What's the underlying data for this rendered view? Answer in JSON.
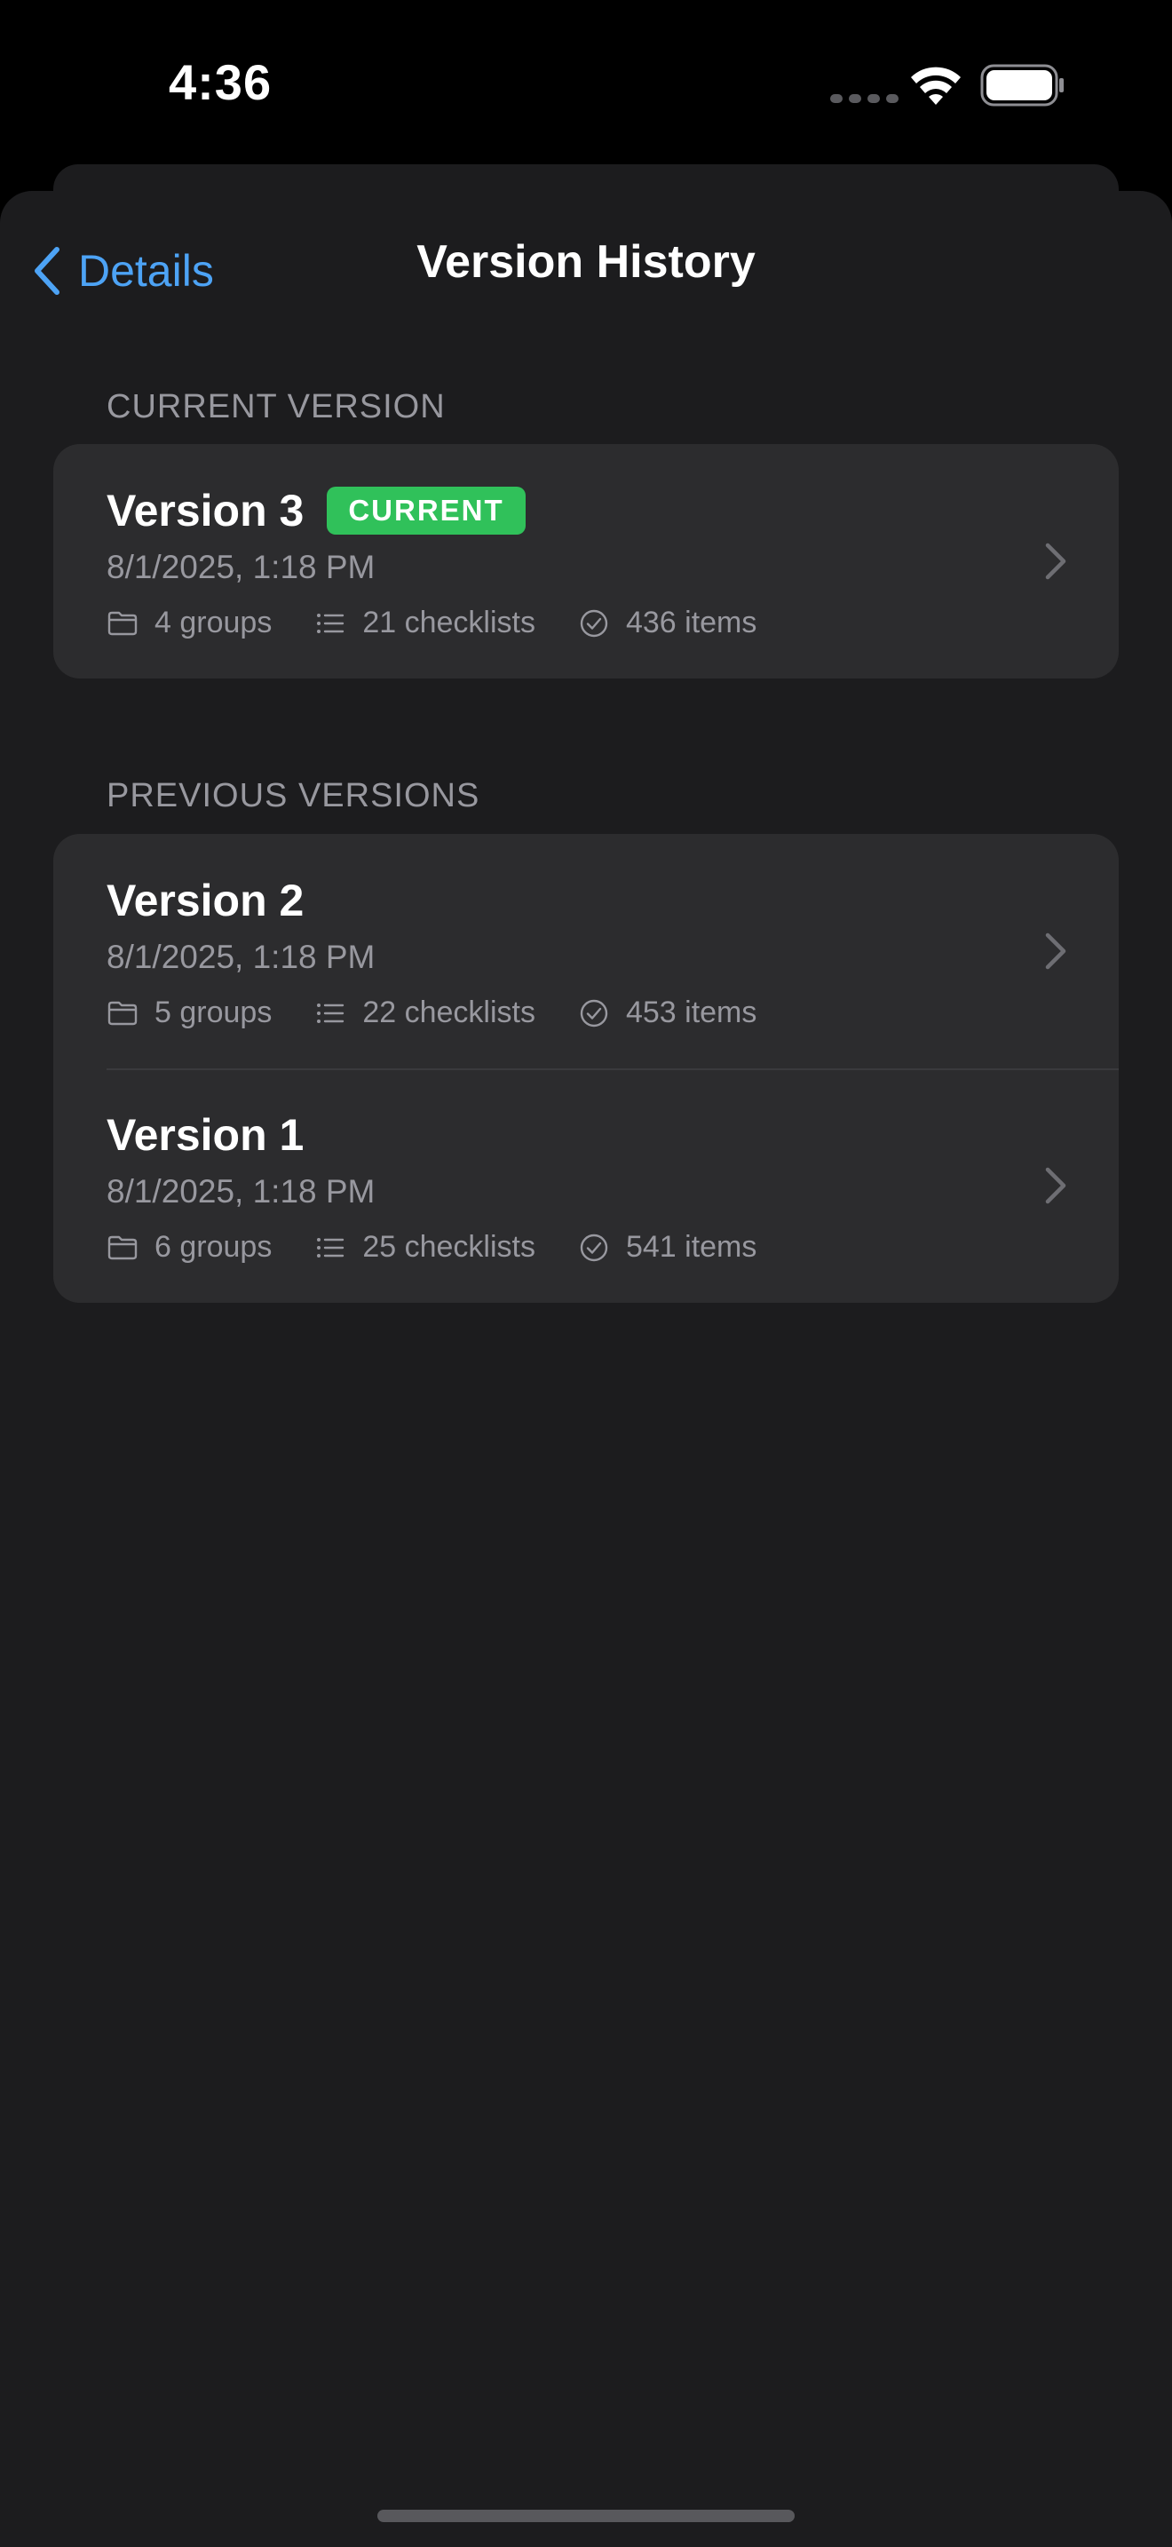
{
  "status_bar": {
    "time": "4:36"
  },
  "nav": {
    "back_label": "Details",
    "title": "Version History"
  },
  "sections": {
    "current_header": "CURRENT VERSION",
    "previous_header": "PREVIOUS VERSIONS"
  },
  "current_version": {
    "title": "Version 3",
    "badge": "CURRENT",
    "date": "8/1/2025, 1:18 PM",
    "groups": "4 groups",
    "checklists": "21 checklists",
    "items": "436 items"
  },
  "previous_versions": [
    {
      "title": "Version 2",
      "date": "8/1/2025, 1:18 PM",
      "groups": "5 groups",
      "checklists": "22 checklists",
      "items": "453 items"
    },
    {
      "title": "Version 1",
      "date": "8/1/2025, 1:18 PM",
      "groups": "6 groups",
      "checklists": "25 checklists",
      "items": "541 items"
    }
  ],
  "colors": {
    "accent": "#4da3f5",
    "badge_green": "#30c15a",
    "background": "#1c1c1e",
    "card": "#2c2c2e",
    "secondary_text": "#98989f"
  },
  "icons": {
    "groups": "folder-icon",
    "checklists": "list-bullet-icon",
    "items": "checkmark-circle-icon",
    "row_disclosure": "chevron-right-icon",
    "back": "chevron-left-icon"
  }
}
